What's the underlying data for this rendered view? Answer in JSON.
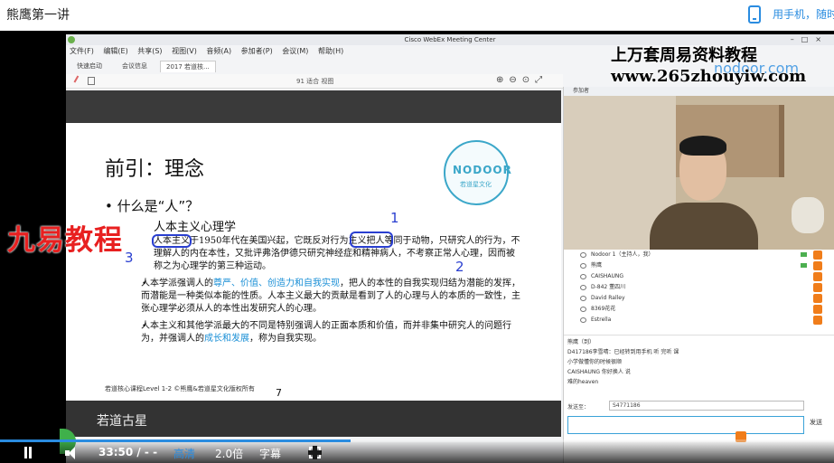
{
  "top": {
    "title": "熊鹰第一讲",
    "mobile_label": "用手机，随时"
  },
  "webex": {
    "window_title": "Cisco WebEx Meeting Center",
    "menu": [
      "文件(F)",
      "编辑(E)",
      "共享(S)",
      "视图(V)",
      "音频(A)",
      "参加者(P)",
      "会议(M)",
      "帮助(H)"
    ],
    "tabs": [
      "快速启动",
      "会议信息",
      "2017 若道核..."
    ],
    "zoom_label": "91 适合 视图"
  },
  "slide": {
    "heading": "前引：理念",
    "question": "• 什么是“人”？",
    "subheading": "人本主义心理学",
    "p1": "人本主义于1950年代在美国兴起，它既反对行为主义把人等同于动物，只研究人的行为，不理解人的内在本性，又批评弗洛伊德只研究神经症和精神病人，不考察正常人心理，因而被称之为心理学的第三种运动。",
    "p2_pre": "人本学派强调人的",
    "p2_hl": "尊严、价值、创造力和自我实现",
    "p2_post": "，把人的本性的自我实现归结为潜能的发挥，而潜能是一种类似本能的性质。人本主义最大的贡献是看到了人的心理与人的本质的一致性，主张心理学必须从人的本性出发研究人的心理。",
    "p3_pre": "人本主义和其他学派最大的不同是特别强调人的正面本质和价值，而并非集中研究人的问题行为，并强调人的",
    "p3_hl": "成长和发展",
    "p3_post": "，称为自我实现。",
    "footer": "若道核心课程Level 1-2  ©熊鹰&若道星文化版权所有",
    "page_number": "7",
    "logo_word": "NODOOR",
    "logo_sub": "若道星文化",
    "ink_1": "1",
    "ink_2": "2",
    "ink_3": "3"
  },
  "participants": {
    "panel_title": "参加者",
    "rows": [
      "Nodoor 1（主持人，我）",
      "熊鹰",
      "CAISHAUNG",
      "D-842 董四川",
      "David Ralley",
      "8369花花",
      "Estrella"
    ]
  },
  "chat": {
    "lines": [
      "熊鹰（到）",
      "D417186李雪晴：已经转到用手机 听 完听 课",
      "小学做懂你的时候很顺",
      "CAISHAUNG 你好换人 说",
      "难的heaven"
    ],
    "send_to_label": "发送至：",
    "send_to_value": "S4771186",
    "send_button": "发送"
  },
  "watermarks": {
    "line1": "上万套周易资料教程",
    "line2": "www.265zhouyiw.com",
    "brand_fragment": "nodoor.com",
    "jiuyi": "九易教程",
    "ruodao": "若道古星"
  },
  "player": {
    "time": "33:50 / - -",
    "quality": "高清",
    "speed": "2.0倍",
    "subtitles": "字幕",
    "progress": 0.42
  }
}
